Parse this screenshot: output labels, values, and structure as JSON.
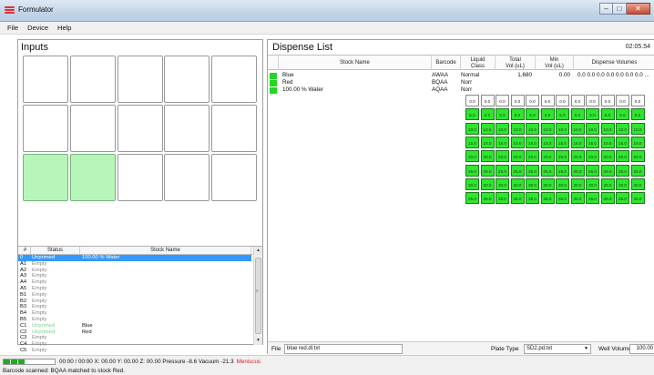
{
  "window": {
    "title": "Formulator"
  },
  "menu": [
    "File",
    "Device",
    "Help"
  ],
  "inputs": {
    "title": "Inputs",
    "list_headers": {
      "id": "#",
      "status": "Status",
      "name": "Stock Name"
    },
    "rows": [
      {
        "id": "0",
        "status": "Unprimed",
        "name": "100.00 % Water",
        "selected": true
      },
      {
        "id": "A1",
        "status": "Empty",
        "name": ""
      },
      {
        "id": "A2",
        "status": "Empty",
        "name": ""
      },
      {
        "id": "A3",
        "status": "Empty",
        "name": ""
      },
      {
        "id": "A4",
        "status": "Empty",
        "name": ""
      },
      {
        "id": "A5",
        "status": "Empty",
        "name": ""
      },
      {
        "id": "B1",
        "status": "Empty",
        "name": ""
      },
      {
        "id": "B2",
        "status": "Empty",
        "name": ""
      },
      {
        "id": "B3",
        "status": "Empty",
        "name": ""
      },
      {
        "id": "B4",
        "status": "Empty",
        "name": ""
      },
      {
        "id": "B5",
        "status": "Empty",
        "name": ""
      },
      {
        "id": "C1",
        "status": "Unprimed",
        "name": "Blue"
      },
      {
        "id": "C2",
        "status": "Unprimed",
        "name": "Red"
      },
      {
        "id": "C3",
        "status": "Empty",
        "name": ""
      },
      {
        "id": "C4",
        "status": "Empty",
        "name": ""
      },
      {
        "id": "C5",
        "status": "Empty",
        "name": ""
      }
    ],
    "grid_green_cells": [
      10,
      11
    ]
  },
  "dispense": {
    "title": "Dispense List",
    "time": "02:05.54",
    "headers": {
      "stock": "Stock Name",
      "barcode": "Barcode",
      "liquid": "Liquid\nClass",
      "total": "Total\nVol (uL)",
      "min": "Min\nVol (uL)",
      "volumes": "Dispense Volumes"
    },
    "rows": [
      {
        "name": "Blue",
        "barcode": "AWAA",
        "liquid": "Normal",
        "total": "1,680",
        "min": "0.00",
        "volumes": "0.0 0.0 0.0 0.0 0.0 0.0 0.0 ..."
      },
      {
        "name": "Red",
        "barcode": "BQAA",
        "liquid": "Norr",
        "total": "",
        "min": "",
        "volumes": ""
      },
      {
        "name": "100.00 % Water",
        "barcode": "AQAA",
        "liquid": "Norr",
        "total": "",
        "min": "",
        "volumes": ""
      }
    ],
    "well_rows": [
      "0.0",
      "5.0",
      "10.0",
      "15.0",
      "20.0",
      "25.0",
      "30.0",
      "35.0"
    ],
    "well_cols": 12,
    "file_label": "File",
    "file_value": "blue red.dl.txt",
    "plate_type_label": "Plate Type",
    "plate_type_value": "SD2.pd.txt",
    "well_volume_label": "Well Volume",
    "well_volume_value": "100.00"
  },
  "status": {
    "line1": "00:00 / 00:00  X: 00.00  Y: 00.00  Z: 00.00  Pressure -8.6  Vacuum -21.3",
    "meniscus": "Meniscus",
    "line2": "Barcode scanned: BQAA matched to stock Red."
  },
  "colors": {
    "well_green": "#2ee62e",
    "grid_green": "#b7f5bb",
    "selection": "#3399ff",
    "meniscus": "#e02020"
  }
}
